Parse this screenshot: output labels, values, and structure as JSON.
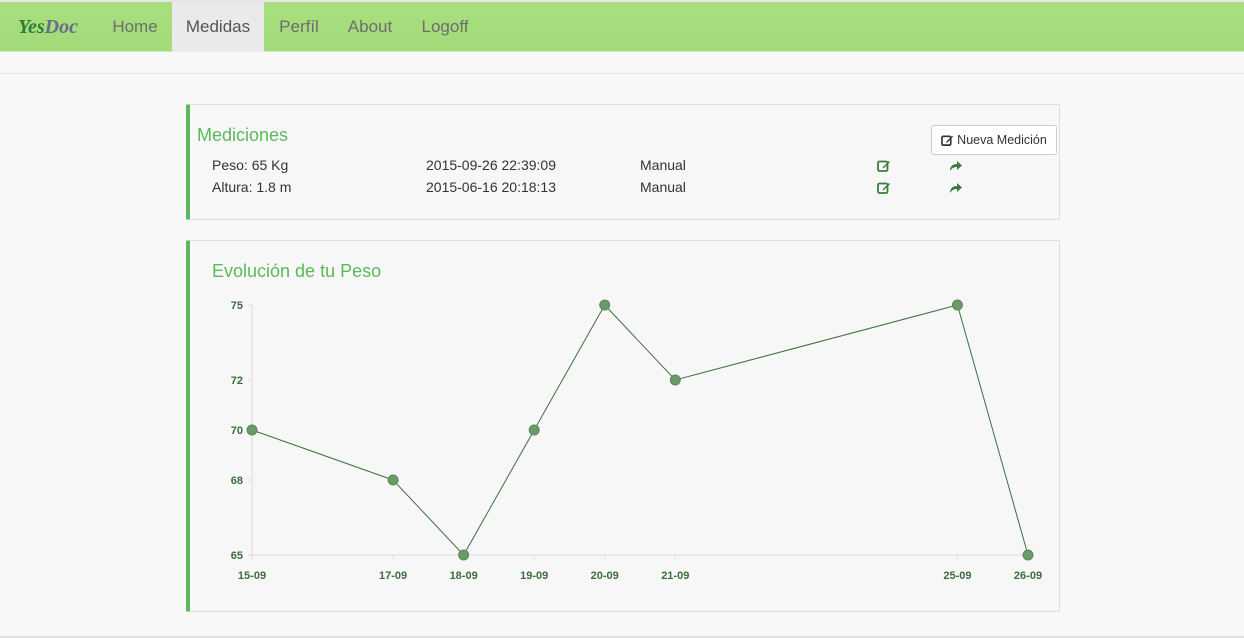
{
  "navbar": {
    "brand_part1": "Yes",
    "brand_part2": "Doc",
    "items": [
      {
        "label": "Home",
        "active": false
      },
      {
        "label": "Medidas",
        "active": true
      },
      {
        "label": "Perfíl",
        "active": false
      },
      {
        "label": "About",
        "active": false
      },
      {
        "label": "Logoff",
        "active": false
      }
    ]
  },
  "mediciones": {
    "title": "Mediciones",
    "new_button_label": "Nueva Medición",
    "rows": [
      {
        "measure": "Peso: 65 Kg",
        "datetime": "2015-09-26 22:39:09",
        "source": "Manual"
      },
      {
        "measure": "Altura: 1.8 m",
        "datetime": "2015-06-16 20:18:13",
        "source": "Manual"
      }
    ]
  },
  "chart_panel": {
    "title": "Evolución de tu Peso"
  },
  "colors": {
    "accent": "#5cb85c",
    "navbar": "#a6dd7c",
    "line": "#3f6f3f",
    "point": "#6a9a6a"
  },
  "chart_data": {
    "type": "line",
    "title": "",
    "xlabel": "",
    "ylabel": "",
    "categories": [
      "15-09",
      "17-09",
      "18-09",
      "19-09",
      "20-09",
      "21-09",
      "25-09",
      "26-09"
    ],
    "day_of_month": [
      15,
      17,
      18,
      19,
      20,
      21,
      25,
      26
    ],
    "series": [
      {
        "values": [
          70,
          68,
          65,
          70,
          75,
          72,
          75,
          65
        ]
      }
    ],
    "y_ticks": [
      65,
      68,
      70,
      72,
      75
    ],
    "ylim": [
      65,
      75
    ],
    "grid": false,
    "legend": "none"
  }
}
